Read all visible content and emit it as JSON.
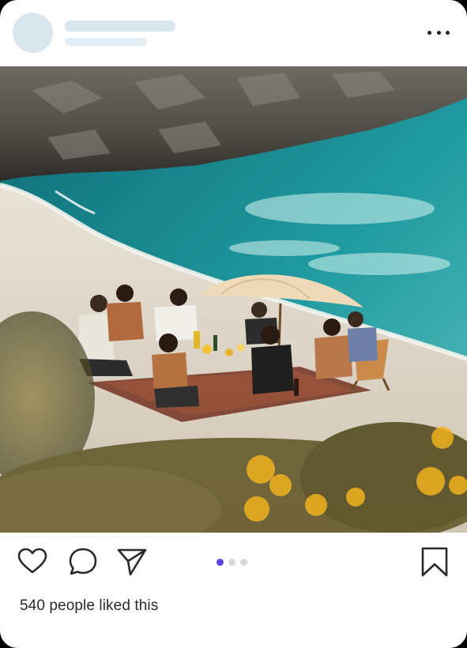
{
  "post": {
    "image_alt": "Friends having a picnic under a beach umbrella on a sandy cove by turquoise water",
    "carousel": {
      "total": 3,
      "active_index": 0
    },
    "likes_text": "540 people liked this"
  },
  "icons": {
    "more": "more-horizontal-icon",
    "like": "heart-icon",
    "comment": "comment-icon",
    "share": "send-icon",
    "save": "bookmark-icon"
  },
  "colors": {
    "skeleton": "#d9e6ee",
    "carousel_active": "#5a43e6",
    "carousel_inactive": "#d8d8d8",
    "text": "#2a2a2a"
  }
}
